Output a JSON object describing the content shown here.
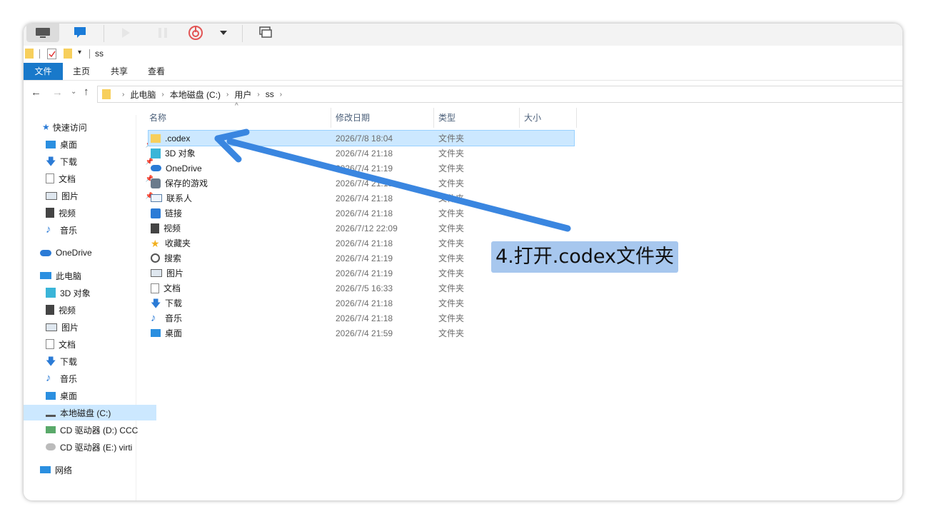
{
  "window": {
    "path_label": "ss"
  },
  "ribbon": {
    "tabs": [
      "文件",
      "主页",
      "共享",
      "查看"
    ]
  },
  "address": {
    "crumbs": [
      "此电脑",
      "本地磁盘 (C:)",
      "用户",
      "ss"
    ]
  },
  "nav": {
    "quick_access": "快速访问",
    "quick_items": [
      "桌面",
      "下载",
      "文档",
      "图片",
      "视频",
      "音乐"
    ],
    "onedrive": "OneDrive",
    "this_pc": "此电脑",
    "pc_items": [
      "3D 对象",
      "视频",
      "图片",
      "文档",
      "下载",
      "音乐",
      "桌面",
      "本地磁盘 (C:)",
      "CD 驱动器 (D:) CCC",
      "CD 驱动器 (E:) virti"
    ],
    "network": "网络"
  },
  "columns": {
    "name": "名称",
    "date": "修改日期",
    "type": "类型",
    "size": "大小"
  },
  "files": [
    {
      "name": ".codex",
      "date": "2026/7/8 18:04",
      "type": "文件夹",
      "icon": "folder-icon"
    },
    {
      "name": "3D 对象",
      "date": "2026/7/4 21:18",
      "type": "文件夹",
      "icon": "cube-icon"
    },
    {
      "name": "OneDrive",
      "date": "2026/7/4 21:19",
      "type": "文件夹",
      "icon": "cloud-icon"
    },
    {
      "name": "保存的游戏",
      "date": "2026/7/4 21:19",
      "type": "文件夹",
      "icon": "games-icon"
    },
    {
      "name": "联系人",
      "date": "2026/7/4 21:18",
      "type": "文件夹",
      "icon": "contacts-icon"
    },
    {
      "name": "链接",
      "date": "2026/7/4 21:18",
      "type": "文件夹",
      "icon": "link-icon"
    },
    {
      "name": "视频",
      "date": "2026/7/12 22:09",
      "type": "文件夹",
      "icon": "video-icon"
    },
    {
      "name": "收藏夹",
      "date": "2026/7/4 21:18",
      "type": "文件夹",
      "icon": "star-icon"
    },
    {
      "name": "搜索",
      "date": "2026/7/4 21:19",
      "type": "文件夹",
      "icon": "search-icon"
    },
    {
      "name": "图片",
      "date": "2026/7/4 21:19",
      "type": "文件夹",
      "icon": "picture-icon"
    },
    {
      "name": "文档",
      "date": "2026/7/5 16:33",
      "type": "文件夹",
      "icon": "document-icon"
    },
    {
      "name": "下载",
      "date": "2026/7/4 21:18",
      "type": "文件夹",
      "icon": "download-icon"
    },
    {
      "name": "音乐",
      "date": "2026/7/4 21:18",
      "type": "文件夹",
      "icon": "music-icon"
    },
    {
      "name": "桌面",
      "date": "2026/7/4 21:59",
      "type": "文件夹",
      "icon": "desktop-icon"
    }
  ],
  "annotation": {
    "text": "4.打开.codex文件夹"
  },
  "colors": {
    "accent": "#1979ca",
    "selection": "#cce8ff",
    "arrow": "#3a86e0",
    "callout": "#a7c7ee"
  }
}
